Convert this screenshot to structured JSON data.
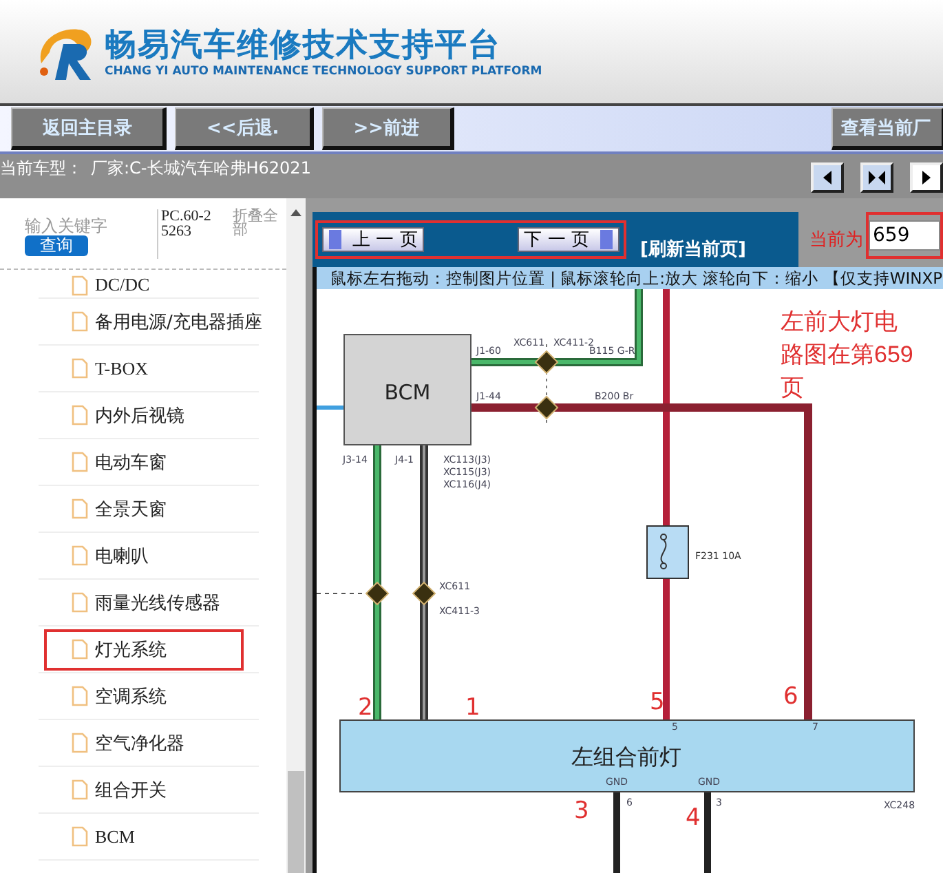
{
  "header": {
    "title": "畅易汽车维修技术支持平台",
    "subtitle": "CHANG YI AUTO MAINTENANCE TECHNOLOGY SUPPORT PLATFORM"
  },
  "toolbar": {
    "buttons": [
      "返回主目录",
      "<<后退.",
      ">>前进"
    ],
    "right_button": "查看当前厂"
  },
  "vehicle_bar": {
    "label": "当前车型：",
    "value": "厂家:C-长城汽车哈弗H62021"
  },
  "sidebar": {
    "search": {
      "placeholder": "输入关键字",
      "button": "查询"
    },
    "code": "PC.60-25263",
    "collapse": "折叠全部",
    "items": [
      {
        "label": "DC/DC",
        "highlighted": false
      },
      {
        "label": "备用电源/充电器插座",
        "highlighted": false
      },
      {
        "label": "T-BOX",
        "highlighted": false
      },
      {
        "label": "内外后视镜",
        "highlighted": false
      },
      {
        "label": "电动车窗",
        "highlighted": false
      },
      {
        "label": "全景天窗",
        "highlighted": false
      },
      {
        "label": "电喇叭",
        "highlighted": false
      },
      {
        "label": "雨量光线传感器",
        "highlighted": false
      },
      {
        "label": "灯光系统",
        "highlighted": true
      },
      {
        "label": "空调系统",
        "highlighted": false
      },
      {
        "label": "空气净化器",
        "highlighted": false
      },
      {
        "label": "组合开关",
        "highlighted": false
      },
      {
        "label": "BCM",
        "highlighted": false
      }
    ]
  },
  "viewer": {
    "pager": {
      "prev": "上 一 页",
      "next": "下 一 页",
      "highlighted": true
    },
    "refresh": "[刷新当前页]",
    "page_label": "当前为",
    "page_field": {
      "value": "659",
      "highlighted": true
    },
    "hint": "鼠标左右拖动：控制图片位置 | 鼠标滚轮向上:放大  滚轮向下：缩小 【仅支持WINXP",
    "diagram": {
      "module": "BCM",
      "lamp": "左组合前灯",
      "fuse": "F231 10A",
      "note": "左前大灯电路图在第659页",
      "labels": [
        {
          "text": "XC611"
        },
        {
          "text": "XC411-2"
        },
        {
          "text": "J1-60"
        },
        {
          "text": "B115 G-R"
        },
        {
          "text": "J1-44"
        },
        {
          "text": "B200 Br"
        },
        {
          "text": "J3-14"
        },
        {
          "text": "J4-1"
        },
        {
          "text": "XC113(J3)"
        },
        {
          "text": "XC115(J3)"
        },
        {
          "text": "XC116(J4)"
        },
        {
          "text": "XC611"
        },
        {
          "text": "XC411-3"
        },
        {
          "text": "GND"
        },
        {
          "text": "GND"
        },
        {
          "text": "XC248"
        },
        {
          "text": "5"
        },
        {
          "text": "7"
        },
        {
          "text": "6"
        },
        {
          "text": "3"
        }
      ],
      "callouts": [
        "2",
        "1",
        "5",
        "6",
        "3",
        "4"
      ]
    }
  }
}
